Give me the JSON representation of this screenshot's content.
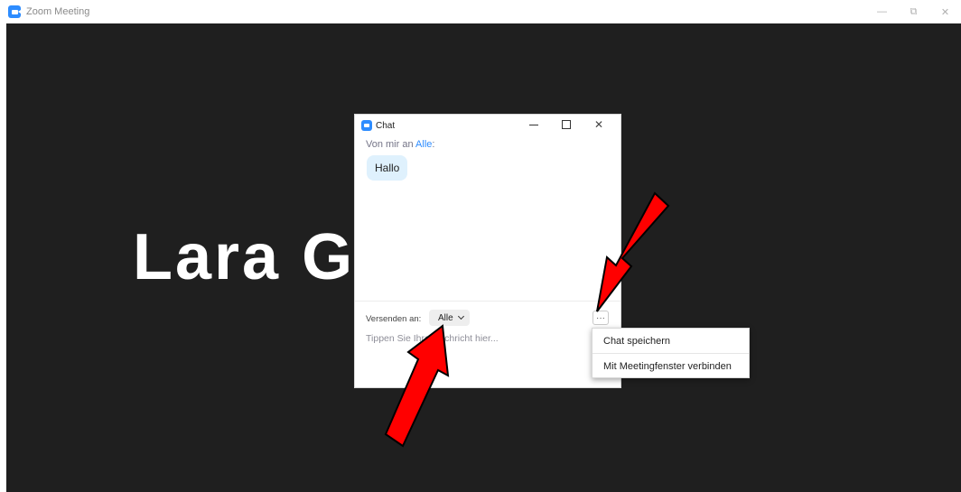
{
  "window": {
    "title": "Zoom Meeting",
    "icon": "zoom-icon",
    "controls": {
      "minimize": "—",
      "restore": "⧉",
      "close": "✕"
    }
  },
  "participant": {
    "name": "Lara Günze..."
  },
  "chat": {
    "title": "Chat",
    "controls": {
      "close": "✕"
    },
    "message": {
      "header_prefix": "Von mir an ",
      "recipient": "Alle",
      "header_suffix": ":",
      "text": "Hallo"
    },
    "send_to_label": "Versenden an:",
    "send_to_value": "Alle",
    "more_label": "···",
    "input_placeholder": "Tippen Sie Ihre Nachricht hier..."
  },
  "context_menu": {
    "items": [
      {
        "label": "Chat speichern"
      },
      {
        "label": "Mit Meetingfenster verbinden"
      }
    ]
  },
  "colors": {
    "stage_bg": "#1f1f1f",
    "accent": "#2d8cff",
    "bubble": "#dff1fd",
    "annotation_arrow": "#ff0000"
  }
}
